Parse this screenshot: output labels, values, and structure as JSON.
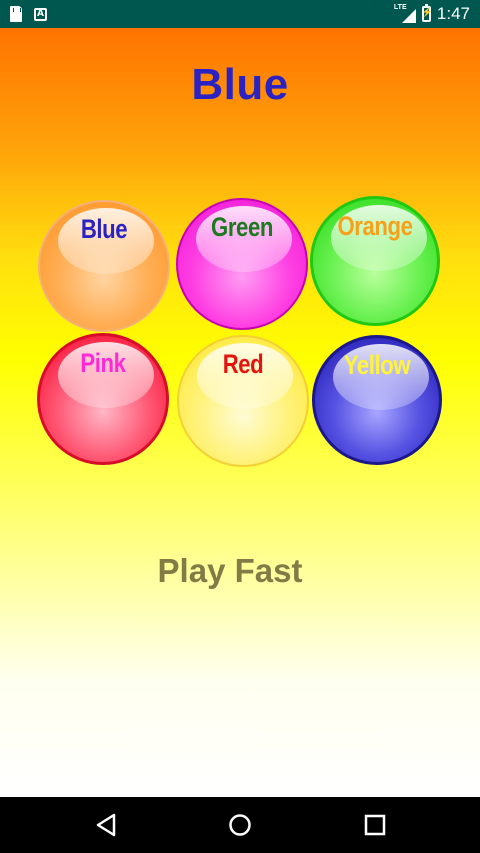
{
  "status_bar": {
    "time": "1:47",
    "network": "LTE",
    "icons": [
      "sd-card-icon",
      "font-a-icon",
      "lte-signal-icon",
      "battery-charging-icon"
    ]
  },
  "game": {
    "target_color": "Blue",
    "balls": [
      {
        "label": "Blue",
        "label_color": "#2a22c2",
        "ball_color": "#ff9a2e"
      },
      {
        "label": "Green",
        "label_color": "#1b7a1e",
        "ball_color": "#ef1ed8"
      },
      {
        "label": "Orange",
        "label_color": "#f7a11a",
        "ball_color": "#34dd22"
      },
      {
        "label": "Pink",
        "label_color": "#ff2ad6",
        "ball_color": "#f7163a"
      },
      {
        "label": "Red",
        "label_color": "#e2140f",
        "ball_color": "#ffe93b"
      },
      {
        "label": "Yellow",
        "label_color": "#fff43a",
        "ball_color": "#2822b6"
      }
    ],
    "play_fast_label": "Play Fast"
  },
  "nav_bar": {
    "icons": [
      "back-icon",
      "home-icon",
      "recent-apps-icon"
    ]
  },
  "colors": {
    "status_bar": "#00574f",
    "title": "#2a22c2",
    "play_fast": "#817c45",
    "gradient_top": "#ff7300",
    "gradient_mid": "#ffff00",
    "gradient_bottom": "#ffffff"
  }
}
